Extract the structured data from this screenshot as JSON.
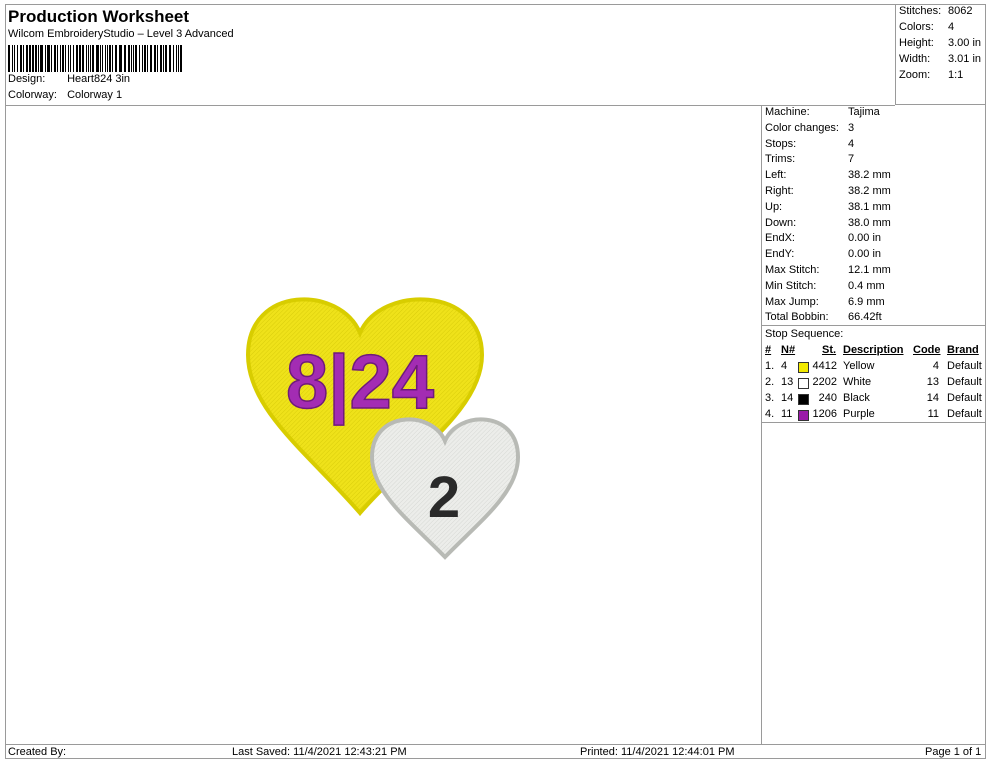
{
  "header": {
    "title": "Production Worksheet",
    "subtitle": "Wilcom EmbroideryStudio – Level 3 Advanced",
    "design_label": "Design:",
    "design_value": "Heart824 3in",
    "colorway_label": "Colorway:",
    "colorway_value": "Colorway 1"
  },
  "stats": {
    "stitches_label": "Stitches:",
    "stitches": "8062",
    "colors_label": "Colors:",
    "colors": "4",
    "height_label": "Height:",
    "height": "3.00 in",
    "width_label": "Width:",
    "width": "3.01 in",
    "zoom_label": "Zoom:",
    "zoom": "1:1"
  },
  "machine": {
    "rows": [
      {
        "k": "Machine:",
        "v": "Tajima"
      },
      {
        "k": "Color changes:",
        "v": "3"
      },
      {
        "k": "Stops:",
        "v": "4"
      },
      {
        "k": "Trims:",
        "v": "7"
      },
      {
        "k": "Left:",
        "v": "38.2 mm"
      },
      {
        "k": "Right:",
        "v": "38.2 mm"
      },
      {
        "k": "Up:",
        "v": "38.1 mm"
      },
      {
        "k": "Down:",
        "v": "38.0 mm"
      },
      {
        "k": "EndX:",
        "v": "0.00 in"
      },
      {
        "k": "EndY:",
        "v": "0.00 in"
      },
      {
        "k": "Max Stitch:",
        "v": "12.1 mm"
      },
      {
        "k": "Min Stitch:",
        "v": "0.4 mm"
      },
      {
        "k": "Max Jump:",
        "v": "6.9 mm"
      },
      {
        "k": "Total Bobbin:",
        "v": "66.42ft"
      }
    ]
  },
  "stop_sequence": {
    "label": "Stop Sequence:",
    "headers": {
      "num": "#",
      "n": "N#",
      "st": "St.",
      "desc": "Description",
      "code": "Code",
      "brand": "Brand"
    },
    "rows": [
      {
        "num": "1.",
        "n": "4",
        "st": "4412",
        "desc": "Yellow",
        "code": "4",
        "brand": "Default",
        "color": "#f2ea00"
      },
      {
        "num": "2.",
        "n": "13",
        "st": "2202",
        "desc": "White",
        "code": "13",
        "brand": "Default",
        "color": "#ffffff"
      },
      {
        "num": "3.",
        "n": "14",
        "st": "240",
        "desc": "Black",
        "code": "14",
        "brand": "Default",
        "color": "#000000"
      },
      {
        "num": "4.",
        "n": "11",
        "st": "1206",
        "desc": "Purple",
        "code": "11",
        "brand": "Default",
        "color": "#9a1aa8"
      }
    ]
  },
  "design_text": {
    "big": "8|24",
    "small": "2"
  },
  "colors": {
    "yellow": "#efe21a",
    "purple": "#a32cb3",
    "white": "#ecedea",
    "black": "#2a2a2a"
  },
  "footer": {
    "created": "Created By:",
    "saved": "Last Saved: 11/4/2021 12:43:21 PM",
    "printed": "Printed: 11/4/2021 12:44:01 PM",
    "page": "Page 1 of 1"
  }
}
